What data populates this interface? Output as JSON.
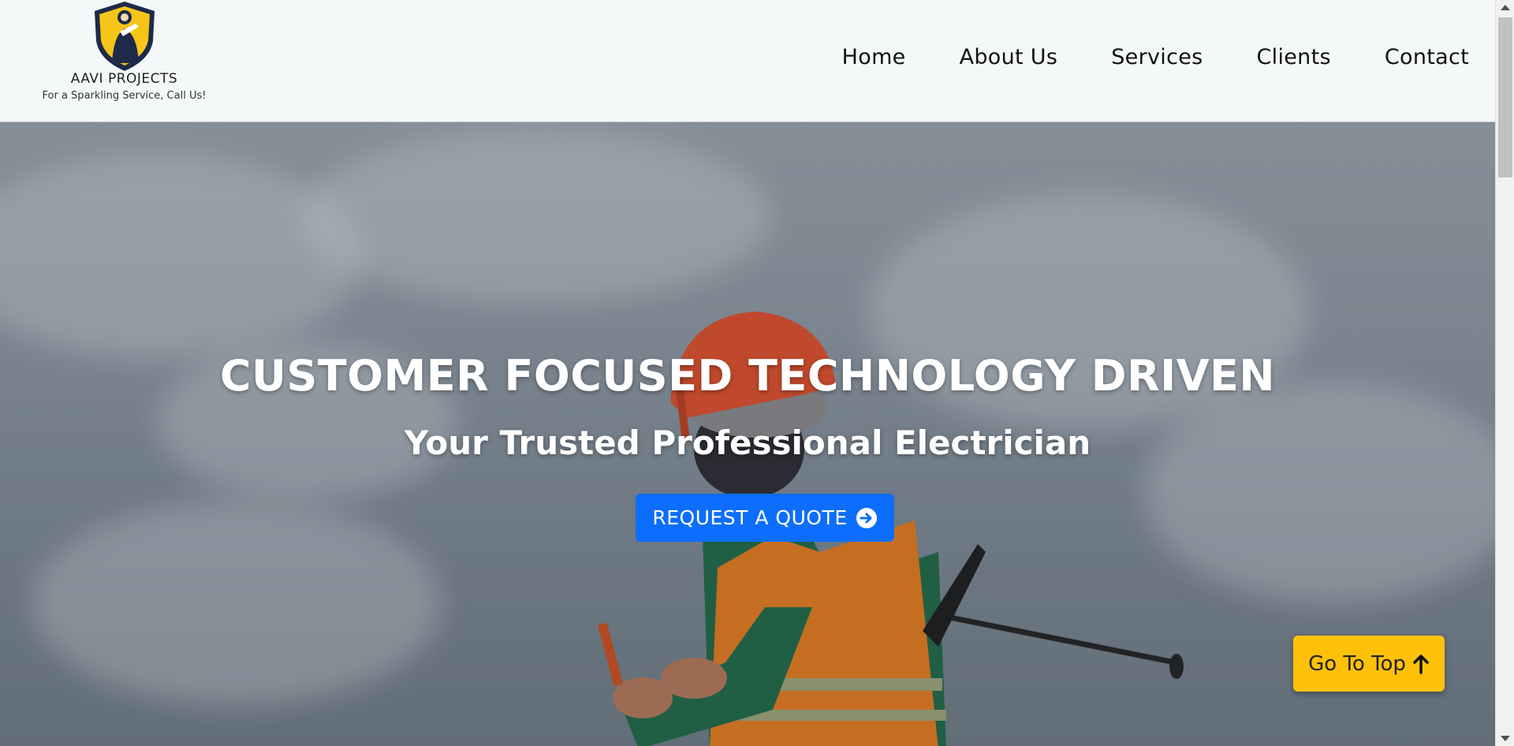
{
  "brand": {
    "name": "AAVI PROJECTS",
    "tagline": "For a Sparkling Service, Call Us!"
  },
  "nav": {
    "items": [
      "Home",
      "About Us",
      "Services",
      "Clients",
      "Contact"
    ]
  },
  "hero": {
    "title": "CUSTOMER FOCUSED TECHNOLOGY DRIVEN",
    "subtitle": "Your Trusted Professional Electrician",
    "cta_label": "REQUEST A QUOTE",
    "cta_icon": "arrow-right-circle-icon"
  },
  "go_top": {
    "label": "Go To Top",
    "icon": "arrow-up-icon"
  },
  "colors": {
    "primary": "#0d6efd",
    "accent": "#ffc107",
    "shield_yellow": "#f5c518",
    "shield_navy": "#1d2a4a"
  }
}
